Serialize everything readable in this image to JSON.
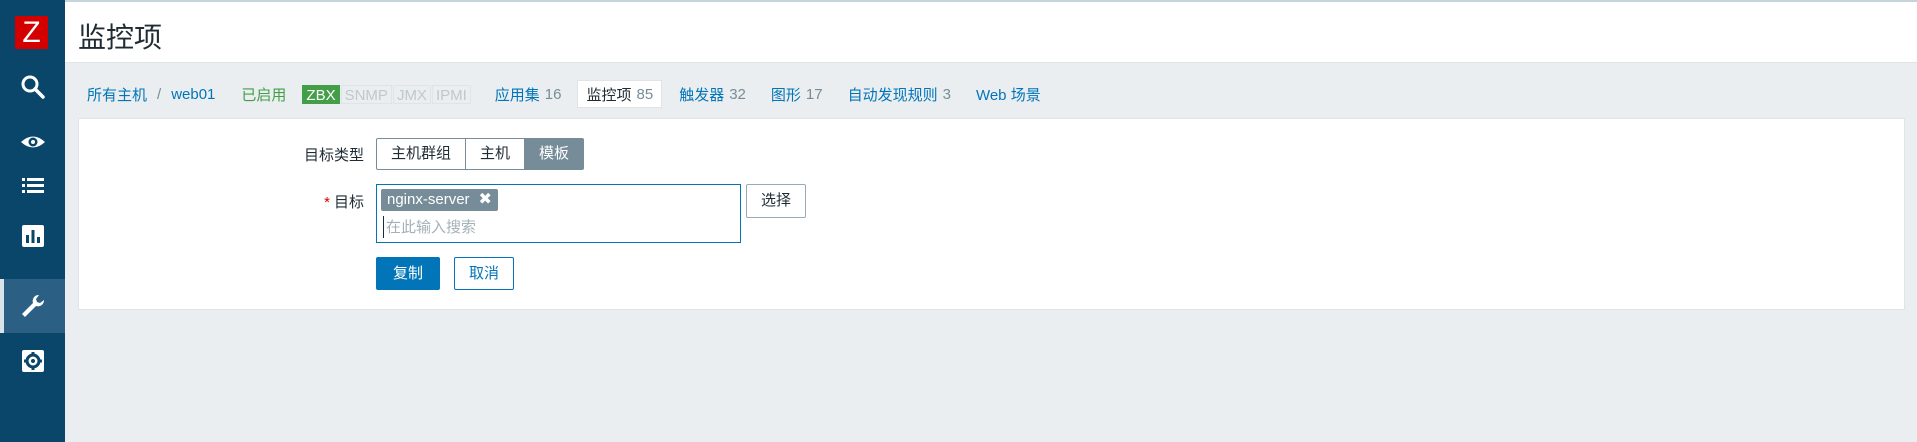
{
  "app": {
    "logo_letter": "Z",
    "brand_color": "#d40000"
  },
  "sidebar": {
    "items": [
      {
        "name": "search",
        "icon": "search-icon"
      },
      {
        "name": "monitoring",
        "icon": "eye-icon"
      },
      {
        "name": "inventory",
        "icon": "list-icon"
      },
      {
        "name": "reports",
        "icon": "chart-icon"
      },
      {
        "name": "configuration",
        "icon": "wrench-icon",
        "active": true
      },
      {
        "name": "administration",
        "icon": "gear-icon"
      }
    ]
  },
  "header": {
    "title": "监控项"
  },
  "host_nav": {
    "all_hosts": "所有主机",
    "separator": "/",
    "host": "web01",
    "status": "已启用",
    "availability": [
      "ZBX",
      "SNMP",
      "JMX",
      "IPMI"
    ],
    "tabs": [
      {
        "label": "应用集",
        "count": "16"
      },
      {
        "label": "监控项",
        "count": "85",
        "selected": true
      },
      {
        "label": "触发器",
        "count": "32"
      },
      {
        "label": "图形",
        "count": "17"
      },
      {
        "label": "自动发现规则",
        "count": "3"
      },
      {
        "label": "Web 场景",
        "count": ""
      }
    ]
  },
  "form": {
    "target_type_label": "目标类型",
    "target_type_options": [
      "主机群组",
      "主机",
      "模板"
    ],
    "target_type_selected": "模板",
    "target_label": "目标",
    "required_marker": "*",
    "target_chip": "nginx-server",
    "chip_remove": "✖",
    "search_placeholder": "在此输入搜索",
    "select_button": "选择",
    "copy_button": "复制",
    "cancel_button": "取消"
  },
  "colors": {
    "sidebar": "#0a466a",
    "accent": "#0275b8",
    "enabled": "#429e47"
  }
}
